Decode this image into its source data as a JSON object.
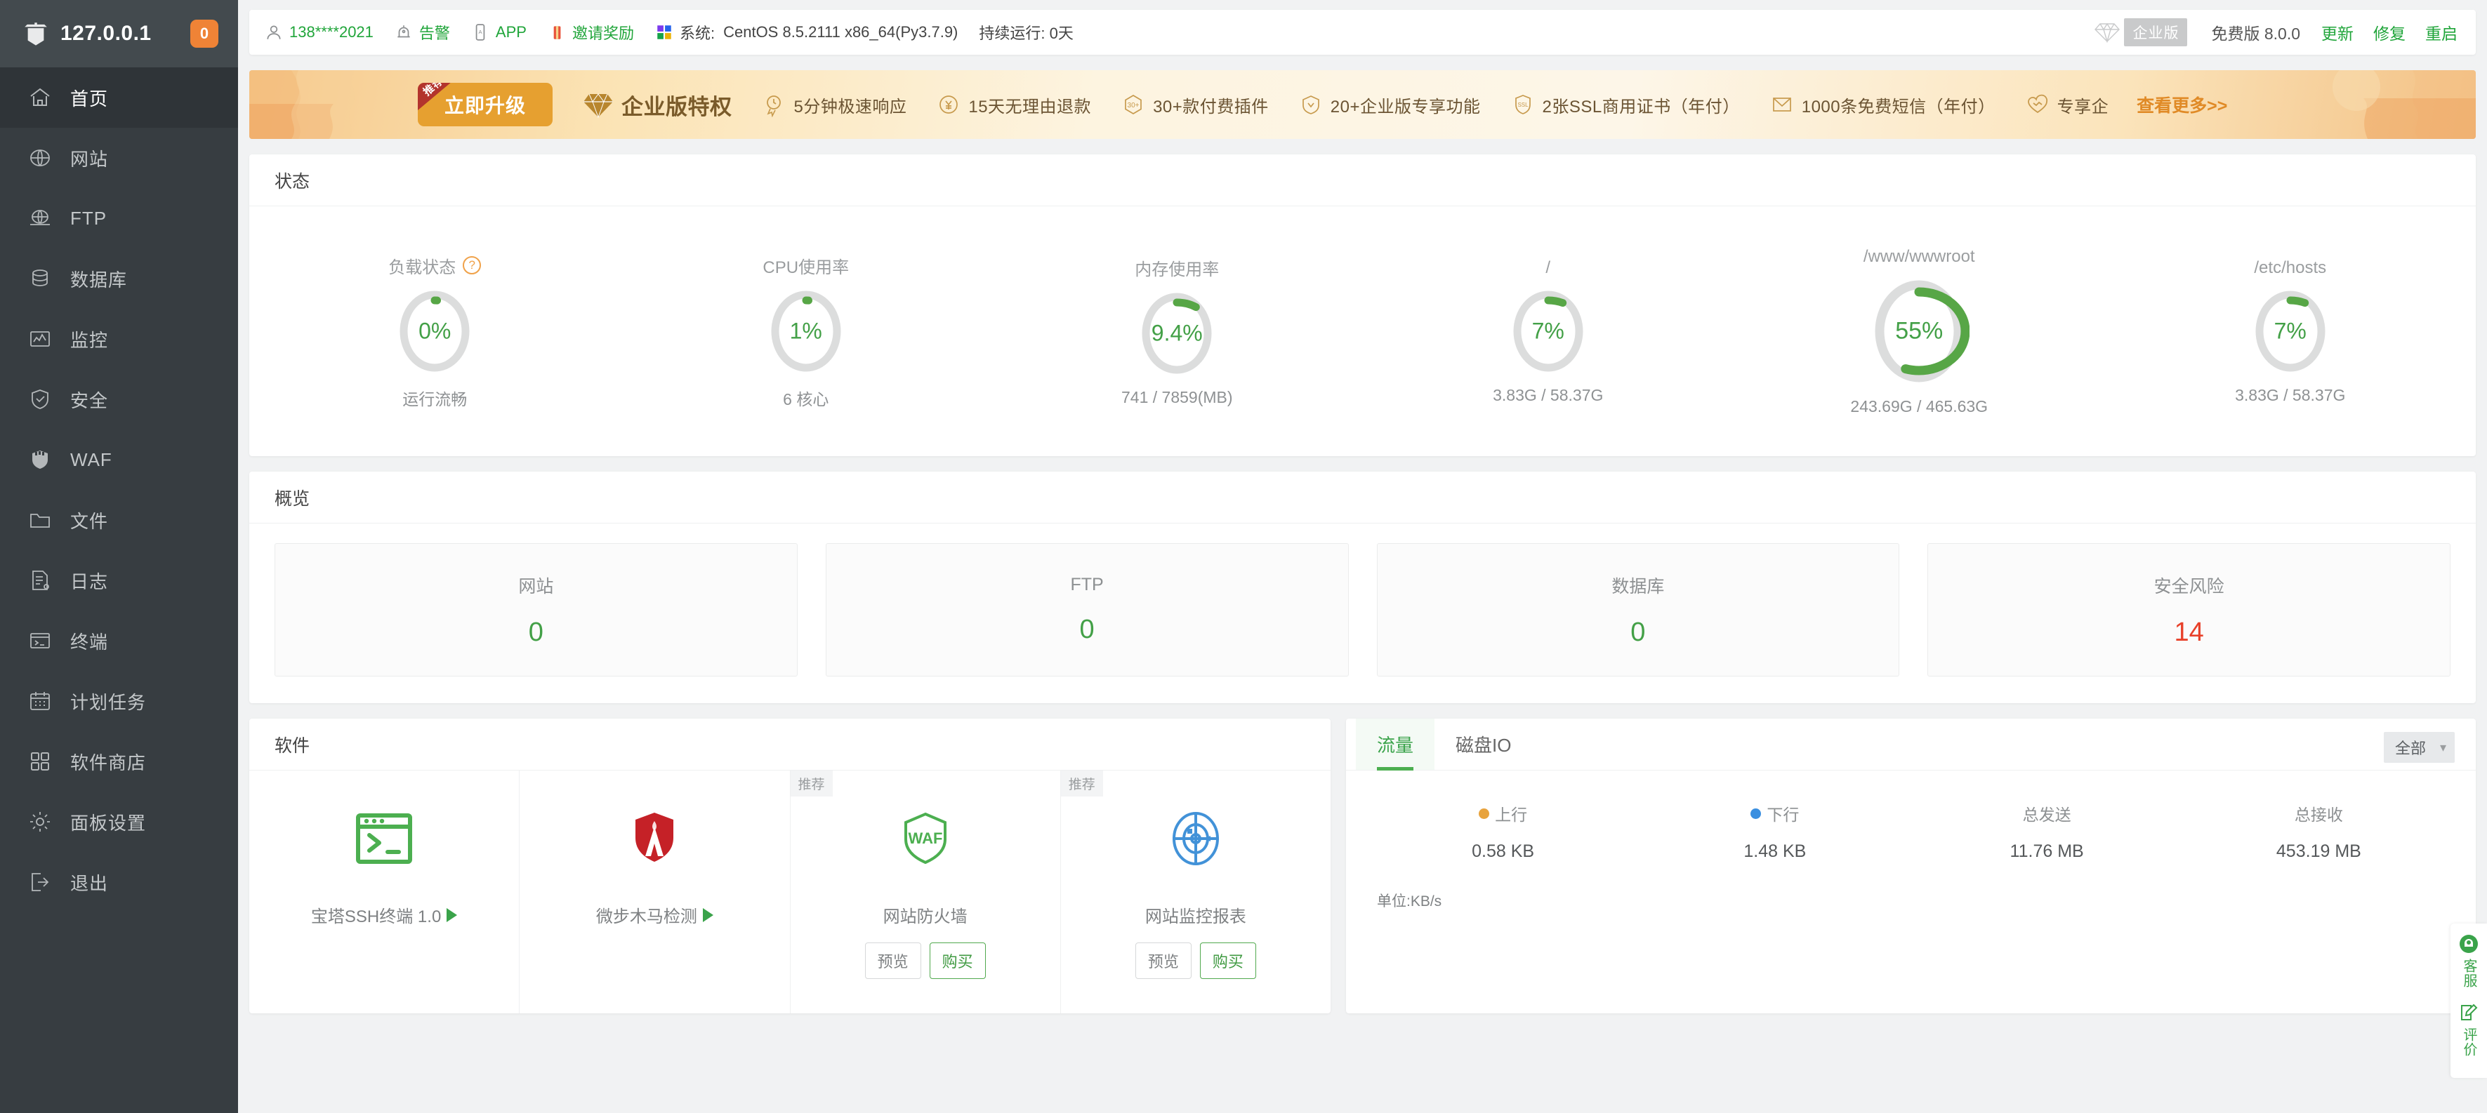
{
  "sidebar": {
    "host": "127.0.0.1",
    "badge": "0",
    "items": [
      {
        "label": "首页",
        "icon": "home-icon",
        "active": true
      },
      {
        "label": "网站",
        "icon": "globe-icon",
        "active": false
      },
      {
        "label": "FTP",
        "icon": "ftp-icon",
        "active": false
      },
      {
        "label": "数据库",
        "icon": "database-icon",
        "active": false
      },
      {
        "label": "监控",
        "icon": "monitor-icon",
        "active": false
      },
      {
        "label": "安全",
        "icon": "shield-check-icon",
        "active": false
      },
      {
        "label": "WAF",
        "icon": "waf-shield-icon",
        "active": false
      },
      {
        "label": "文件",
        "icon": "folder-icon",
        "active": false
      },
      {
        "label": "日志",
        "icon": "log-icon",
        "active": false
      },
      {
        "label": "终端",
        "icon": "terminal-icon",
        "active": false
      },
      {
        "label": "计划任务",
        "icon": "calendar-icon",
        "active": false
      },
      {
        "label": "软件商店",
        "icon": "grid-icon",
        "active": false
      },
      {
        "label": "面板设置",
        "icon": "gear-icon",
        "active": false
      },
      {
        "label": "退出",
        "icon": "logout-icon",
        "active": false
      }
    ]
  },
  "topbar": {
    "user": "138****2021",
    "alert": "告警",
    "app": "APP",
    "invite": "邀请奖励",
    "system_label": "系统:",
    "system_value": "CentOS 8.5.2111 x86_64(Py3.7.9)",
    "uptime": "持续运行: 0天",
    "enterprise_badge": "企业版",
    "version": "免费版 8.0.0",
    "update": "更新",
    "repair": "修复",
    "restart": "重启"
  },
  "promo": {
    "upgrade_button": "立即升级",
    "recommend_tag": "推荐",
    "features": [
      {
        "text": "企业版特权",
        "icon": "diamond-icon",
        "primary": true
      },
      {
        "text": "5分钟极速响应",
        "icon": "clock-bolt-icon",
        "primary": false
      },
      {
        "text": "15天无理由退款",
        "icon": "refund-icon",
        "primary": false
      },
      {
        "text": "30+款付费插件",
        "icon": "plugin-30-icon",
        "primary": false
      },
      {
        "text": "20+企业版专享功能",
        "icon": "shield-v-icon",
        "primary": false
      },
      {
        "text": "2张SSL商用证书（年付）",
        "icon": "ssl-icon",
        "primary": false
      },
      {
        "text": "1000条免费短信（年付）",
        "icon": "mail-icon",
        "primary": false
      },
      {
        "text": "专享企",
        "icon": "heart-icon",
        "primary": false
      }
    ],
    "more": "查看更多>>"
  },
  "status": {
    "title": "状态",
    "gauges": [
      {
        "title": "负载状态",
        "has_help": true,
        "percent": "0%",
        "value": 0,
        "sub": "运行流畅",
        "size": "normal"
      },
      {
        "title": "CPU使用率",
        "has_help": false,
        "percent": "1%",
        "value": 1,
        "sub": "6 核心",
        "size": "normal"
      },
      {
        "title": "内存使用率",
        "has_help": false,
        "percent": "9.4%",
        "value": 9.4,
        "sub": "741 / 7859(MB)",
        "size": "normal"
      },
      {
        "title": "/",
        "has_help": false,
        "percent": "7%",
        "value": 7,
        "sub": "3.83G / 58.37G",
        "size": "normal"
      },
      {
        "title": "/www/wwwroot",
        "has_help": false,
        "percent": "55%",
        "value": 55,
        "sub": "243.69G / 465.63G",
        "size": "big"
      },
      {
        "title": "/etc/hosts",
        "has_help": false,
        "percent": "7%",
        "value": 7,
        "sub": "3.83G / 58.37G",
        "size": "normal"
      }
    ]
  },
  "overview": {
    "title": "概览",
    "boxes": [
      {
        "label": "网站",
        "value": "0",
        "risk": false
      },
      {
        "label": "FTP",
        "value": "0",
        "risk": false
      },
      {
        "label": "数据库",
        "value": "0",
        "risk": false
      },
      {
        "label": "安全风险",
        "value": "14",
        "risk": true
      }
    ]
  },
  "software": {
    "title": "软件",
    "items": [
      {
        "name": "宝塔SSH终端 1.0",
        "icon": "ssh-terminal-icon",
        "tag": "",
        "has_play": true,
        "buttons": []
      },
      {
        "name": "微步木马检测",
        "icon": "trojan-scan-icon",
        "tag": "",
        "has_play": true,
        "buttons": []
      },
      {
        "name": "网站防火墙",
        "icon": "waf-logo-icon",
        "tag": "推荐",
        "has_play": false,
        "buttons": [
          "预览",
          "购买"
        ]
      },
      {
        "name": "网站监控报表",
        "icon": "monitor-report-icon",
        "tag": "推荐",
        "has_play": false,
        "buttons": [
          "预览",
          "购买"
        ]
      }
    ]
  },
  "traffic": {
    "tabs": [
      {
        "label": "流量",
        "active": true
      },
      {
        "label": "磁盘IO",
        "active": false
      }
    ],
    "filter": "全部",
    "stats": [
      {
        "label": "上行",
        "dot": "up",
        "value": "0.58 KB"
      },
      {
        "label": "下行",
        "dot": "down",
        "value": "1.48 KB"
      },
      {
        "label": "总发送",
        "dot": "",
        "value": "11.76 MB"
      },
      {
        "label": "总接收",
        "dot": "",
        "value": "453.19 MB"
      }
    ],
    "unit": "单位:KB/s"
  },
  "dock": {
    "items": [
      {
        "label": "客服",
        "icon": "headset-icon"
      },
      {
        "label": "评价",
        "icon": "edit-square-icon"
      }
    ]
  },
  "colors": {
    "accent_green": "#3aa34a",
    "gauge_green": "#57a646",
    "risk_red": "#e8412a",
    "badge_orange": "#ef8336",
    "sidebar_bg": "#373d41"
  },
  "chart_data": {
    "type": "table",
    "title": "流量",
    "categories": [
      "上行",
      "下行",
      "总发送",
      "总接收"
    ],
    "values": [
      "0.58 KB",
      "1.48 KB",
      "11.76 MB",
      "453.19 MB"
    ],
    "ylabel": "单位:KB/s"
  }
}
